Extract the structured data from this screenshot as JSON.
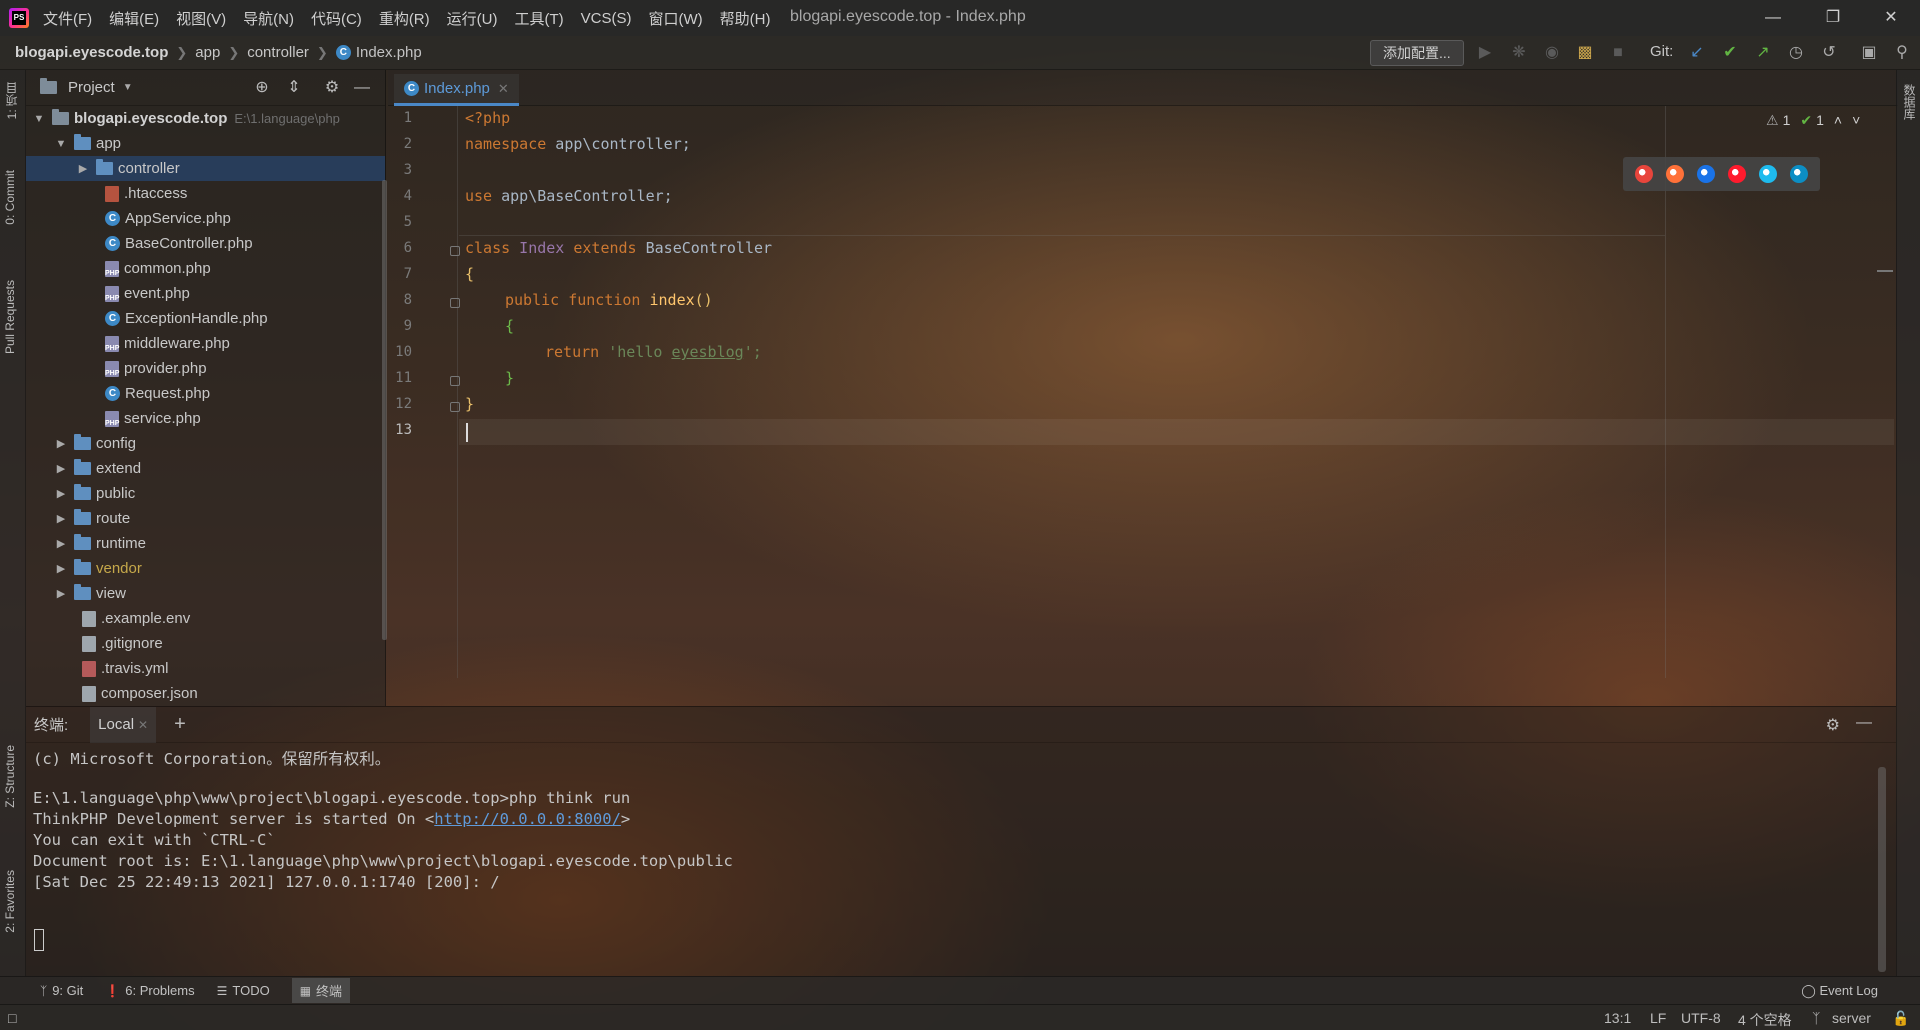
{
  "menu": [
    "文件(F)",
    "编辑(E)",
    "视图(V)",
    "导航(N)",
    "代码(C)",
    "重构(R)",
    "运行(U)",
    "工具(T)",
    "VCS(S)",
    "窗口(W)",
    "帮助(H)"
  ],
  "window_title": "blogapi.eyescode.top - Index.php",
  "breadcrumb": {
    "project": "blogapi.eyescode.top",
    "app": "app",
    "controller": "controller",
    "file": "Index.php"
  },
  "toolbar": {
    "add_config": "添加配置...",
    "git_label": "Git:"
  },
  "left_strip": {
    "project_tab": "1: 项目",
    "commit_tab": "0: Commit",
    "pull_requests_tab": "Pull Requests",
    "structure_tab": "Z: Structure",
    "favorites_tab": "2: Favorites"
  },
  "right_strip": {
    "database_tab": "数据库"
  },
  "project_panel": {
    "title": "Project",
    "root_name": "blogapi.eyescode.top",
    "root_path": "E:\\1.language\\php",
    "items": [
      {
        "name": "app"
      },
      {
        "name": "controller"
      },
      {
        "name": ".htaccess"
      },
      {
        "name": "AppService.php"
      },
      {
        "name": "BaseController.php"
      },
      {
        "name": "common.php"
      },
      {
        "name": "event.php"
      },
      {
        "name": "ExceptionHandle.php"
      },
      {
        "name": "middleware.php"
      },
      {
        "name": "provider.php"
      },
      {
        "name": "Request.php"
      },
      {
        "name": "service.php"
      },
      {
        "name": "config"
      },
      {
        "name": "extend"
      },
      {
        "name": "public"
      },
      {
        "name": "route"
      },
      {
        "name": "runtime"
      },
      {
        "name": "vendor"
      },
      {
        "name": "view"
      },
      {
        "name": ".example.env"
      },
      {
        "name": ".gitignore"
      },
      {
        "name": ".travis.yml"
      },
      {
        "name": "composer.json"
      }
    ]
  },
  "editor": {
    "tab_label": "Index.php",
    "line_numbers": [
      "1",
      "2",
      "3",
      "4",
      "5",
      "6",
      "7",
      "8",
      "9",
      "10",
      "11",
      "12",
      "13"
    ],
    "code": {
      "l1_open": "<?php",
      "l2_kw": "namespace",
      "l2_rest": " app\\controller;",
      "l4_kw": "use",
      "l4_rest": " app\\BaseController;",
      "l6_kw1": "class",
      "l6_name": " Index ",
      "l6_kw2": "extends",
      "l6_rest": " BaseController",
      "l7": "{",
      "l8_kw": "public function",
      "l8_fn": " index",
      "l8_paren": "()",
      "l9": "{",
      "l10_kw": "return",
      "l10_str_a": " 'hello ",
      "l10_str_b": "eyesblog",
      "l10_str_c": "';",
      "l11": "}",
      "l12": "}"
    },
    "inspections": {
      "warnings": "1",
      "ok": "1"
    },
    "browser_colors": [
      "#e8453c",
      "#ff7139",
      "#1a73e8",
      "#ff1b2d",
      "#1ebbee",
      "#0c8ec4"
    ]
  },
  "terminal": {
    "title": "终端:",
    "tab": "Local",
    "lines": [
      "(c) Microsoft Corporation。保留所有权利。",
      "",
      "E:\\1.language\\php\\www\\project\\blogapi.eyescode.top>php think run",
      "ThinkPHP Development server is started On <",
      "You can exit with `CTRL-C`",
      "Document root is: E:\\1.language\\php\\www\\project\\blogapi.eyescode.top\\public",
      "[Sat Dec 25 22:49:13 2021] 127.0.0.1:1740 [200]: /"
    ],
    "link": "http://0.0.0.0:8000/",
    "link_suffix": ">"
  },
  "bottom_tools": {
    "git": "9: Git",
    "problems": "6: Problems",
    "todo": "TODO",
    "terminal": "终端",
    "event_log": "Event Log"
  },
  "status": {
    "position": "13:1",
    "line_sep": "LF",
    "encoding": "UTF-8",
    "indent": "4 个空格",
    "branch": "server"
  }
}
